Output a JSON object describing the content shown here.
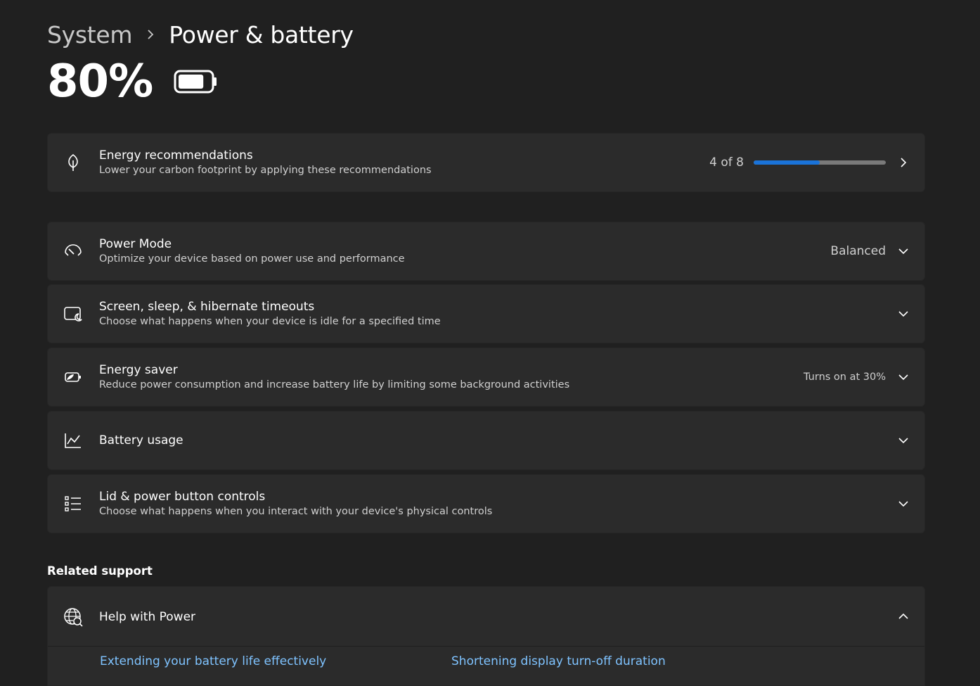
{
  "breadcrumb": {
    "parent": "System",
    "current": "Power & battery"
  },
  "battery": {
    "percent_label": "80%",
    "level": 0.8
  },
  "energy_recommendations": {
    "title": "Energy recommendations",
    "subtitle": "Lower your carbon footprint by applying these recommendations",
    "progress_label": "4 of 8",
    "progress_value": 0.5,
    "icon": "leaf-icon"
  },
  "settings": [
    {
      "title": "Power Mode",
      "subtitle": "Optimize your device based on power use and performance",
      "value": "Balanced",
      "icon": "power-mode-gauge-icon"
    },
    {
      "title": "Screen, sleep, & hibernate timeouts",
      "subtitle": "Choose what happens when your device is idle for a specified time",
      "value": "",
      "icon": "screen-sleep-icon"
    },
    {
      "title": "Energy saver",
      "subtitle": "Reduce power consumption and increase battery life by limiting some background activities",
      "value": "Turns on at 30%",
      "icon": "energy-saver-icon"
    },
    {
      "title": "Battery usage",
      "subtitle": "",
      "value": "",
      "icon": "chart-line-icon"
    },
    {
      "title": "Lid & power button controls",
      "subtitle": "Choose what happens when you interact with your device's physical controls",
      "value": "",
      "icon": "list-controls-icon"
    }
  ],
  "related_support": {
    "heading": "Related support",
    "help_title": "Help with Power",
    "links": [
      "Extending your battery life effectively",
      "Shortening display turn-off duration"
    ],
    "icon": "globe-help-icon"
  },
  "colors": {
    "background": "#202020",
    "card": "#2b2b2b",
    "accent": "#1a73d9",
    "link": "#7fc3ff"
  }
}
